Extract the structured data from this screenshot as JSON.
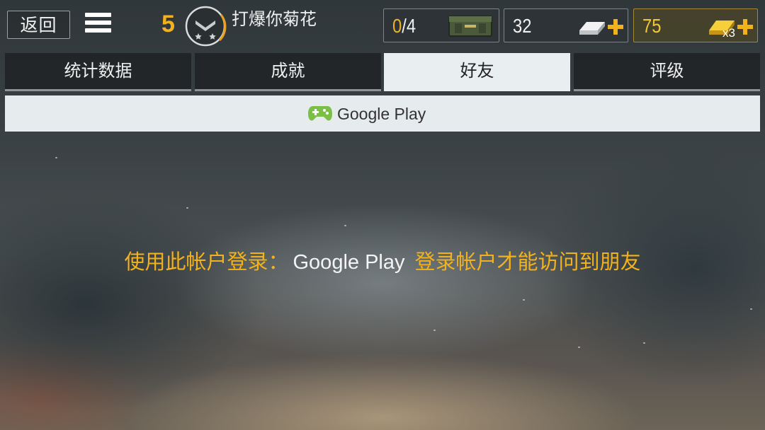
{
  "header": {
    "back_label": "返回",
    "level": "5",
    "player_name": "打爆你菊花",
    "crates": {
      "current": "0",
      "slash_max": "/4"
    },
    "silver": "32",
    "gold": "75",
    "gold_bonus": "x3",
    "accent_color": "#f2b21e"
  },
  "tabs": [
    {
      "label": "统计数据",
      "active": false
    },
    {
      "label": "成就",
      "active": false
    },
    {
      "label": "好友",
      "active": true
    },
    {
      "label": "评级",
      "active": false
    }
  ],
  "google_play_bar": {
    "label": "Google Play",
    "icon": "gamepad-icon"
  },
  "message": {
    "prefix": "使用此帐户登录：",
    "service": "Google Play",
    "suffix": "登录帐户才能访问到朋友"
  }
}
